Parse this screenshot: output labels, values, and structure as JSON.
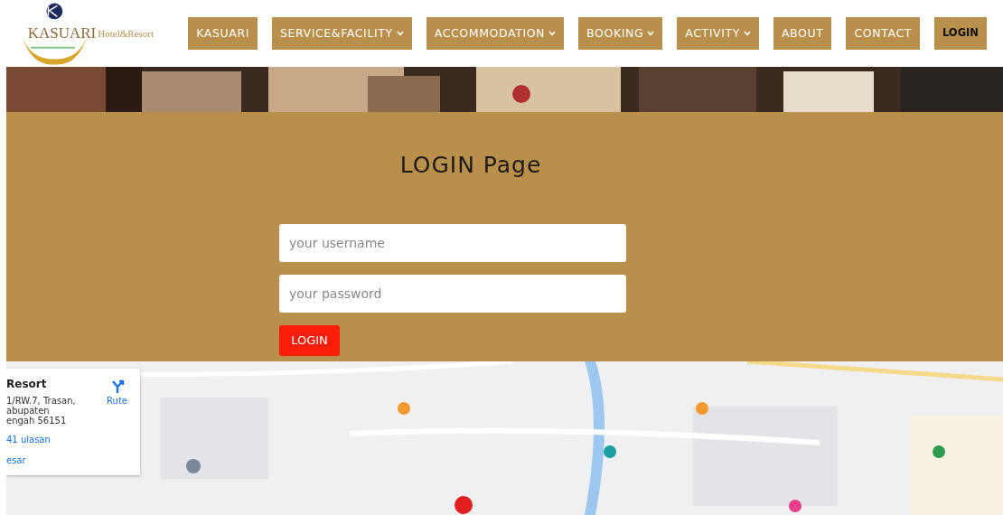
{
  "logo": {
    "name": "KASUARI",
    "tagline": "Hotel&Resort"
  },
  "menu": [
    {
      "label": "KASUARI",
      "has_dropdown": false,
      "selected": false
    },
    {
      "label": "SERVICE&FACILITY",
      "has_dropdown": true,
      "selected": false
    },
    {
      "label": "ACCOMMODATION",
      "has_dropdown": true,
      "selected": false
    },
    {
      "label": "BOOKING",
      "has_dropdown": true,
      "selected": false
    },
    {
      "label": "ACTIVITY",
      "has_dropdown": true,
      "selected": false
    },
    {
      "label": "ABOUT",
      "has_dropdown": false,
      "selected": false
    },
    {
      "label": "CONTACT",
      "has_dropdown": false,
      "selected": false
    },
    {
      "label": "LOGIN",
      "has_dropdown": false,
      "selected": true
    }
  ],
  "login": {
    "title": "LOGIN Page",
    "username": {
      "placeholder": "your username"
    },
    "password": {
      "placeholder": "your password"
    },
    "button": "LOGIN"
  },
  "map": {
    "kind": "picture",
    "place_card": {
      "title": "Resort",
      "address_lines": [
        "1/RW.7, Trasan,",
        "abupaten",
        "engah 56151"
      ],
      "reviews": "41 ulasan",
      "larger_map": "esar",
      "directions": "Rute"
    }
  }
}
